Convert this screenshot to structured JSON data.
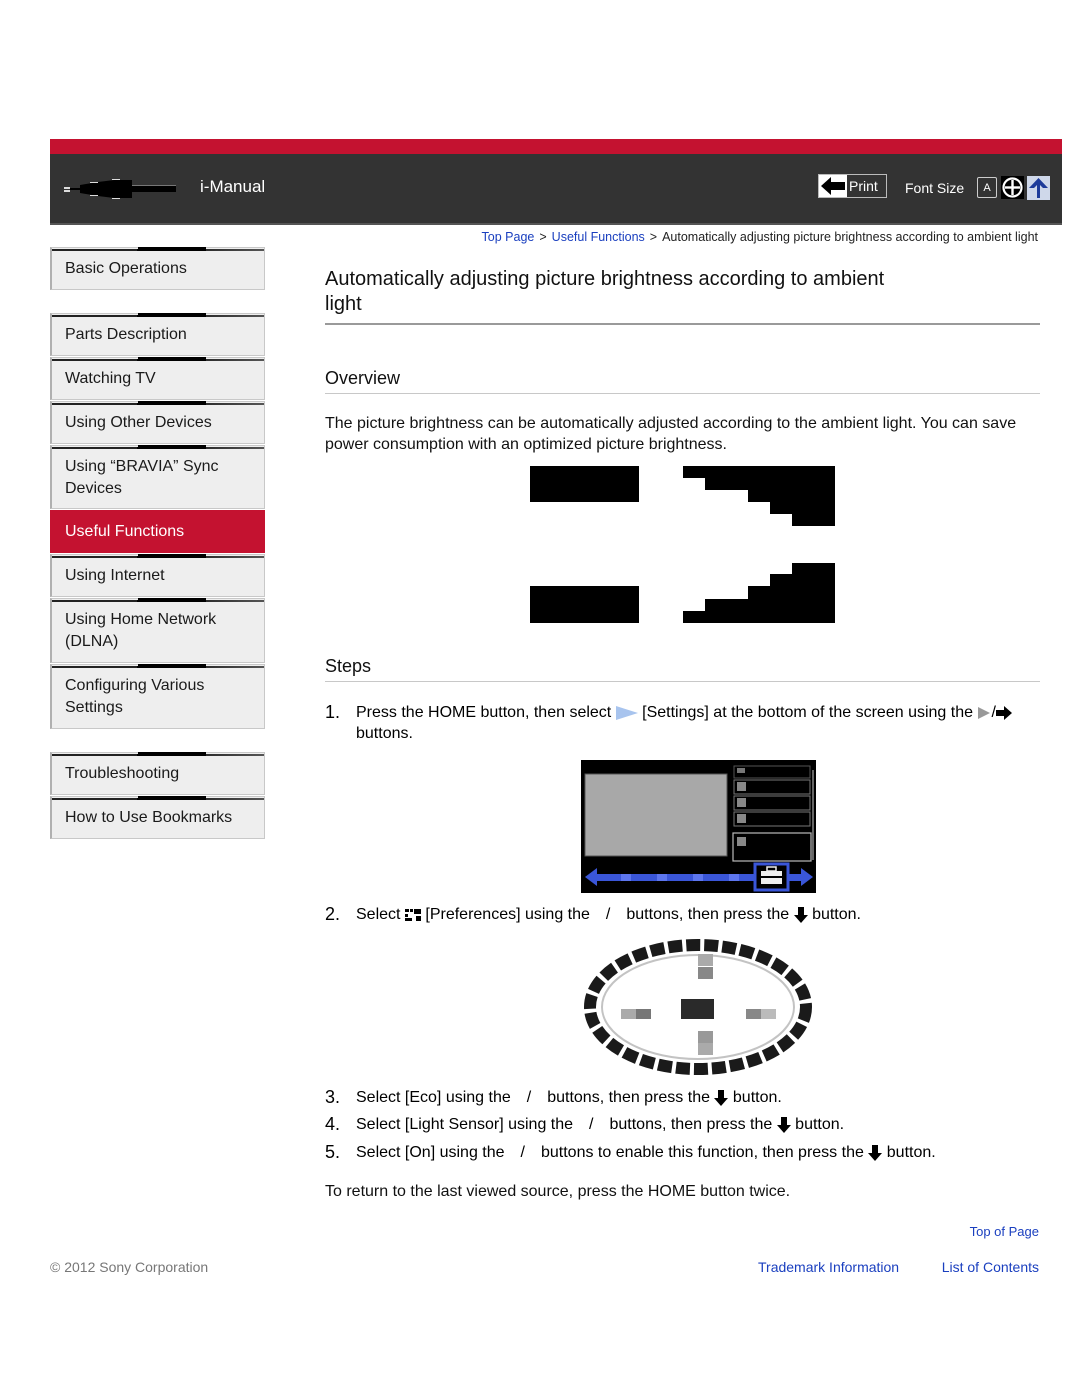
{
  "header": {
    "app_title": "i-Manual",
    "print_label": "Print",
    "font_size_label": "Font Size",
    "font_a_label": "A",
    "colors": {
      "brand_red": "#c41230",
      "header_bg": "#333333",
      "link_blue": "#1a3fbf"
    }
  },
  "breadcrumb": {
    "items": [
      "Top Page",
      "Useful Functions"
    ],
    "current": "Automatically adjusting picture brightness according to ambient light",
    "separator": ">"
  },
  "sidebar": {
    "items": [
      {
        "label": "Basic Operations",
        "active": false
      },
      {
        "label": "Parts Description",
        "active": false
      },
      {
        "label": "Watching TV",
        "active": false
      },
      {
        "label": "Using Other Devices",
        "active": false
      },
      {
        "label": "Using “BRAVIA” Sync Devices",
        "active": false
      },
      {
        "label": "Useful Functions",
        "active": true
      },
      {
        "label": "Using Internet",
        "active": false
      },
      {
        "label": "Using Home Network (DLNA)",
        "active": false
      },
      {
        "label": "Configuring Various Settings",
        "active": false
      },
      {
        "label": "Troubleshooting",
        "active": false
      },
      {
        "label": "How to Use Bookmarks",
        "active": false
      }
    ]
  },
  "main": {
    "title": "Automatically adjusting picture brightness according to ambient light",
    "overview": {
      "heading": "Overview",
      "text": "The picture brightness can be automatically adjusted according to the ambient light. You can save power consumption with an optimized picture brightness."
    },
    "steps": {
      "heading": "Steps",
      "items": [
        {
          "num": "1.",
          "parts": [
            "Press the HOME button, then select",
            "[Settings] at the bottom of the screen using the",
            "/",
            "buttons."
          ]
        },
        {
          "num": "2.",
          "parts": [
            "Select",
            "[Preferences] using the",
            "/",
            "buttons, then press the",
            "button."
          ]
        },
        {
          "num": "3.",
          "parts": [
            "Select [Eco] using the",
            "/",
            "buttons, then press the",
            "button."
          ]
        },
        {
          "num": "4.",
          "parts": [
            "Select [Light Sensor] using the",
            "/",
            "buttons, then press the",
            "button."
          ]
        },
        {
          "num": "5.",
          "parts": [
            "Select [On] using the",
            "/",
            "buttons to enable this function, then press the",
            "button."
          ]
        }
      ]
    },
    "return_note": "To return to the last viewed source, press the HOME button twice."
  },
  "footer": {
    "top_of_page": "Top of Page",
    "copyright": "© 2012 Sony Corporation",
    "trademark": "Trademark Information",
    "list_of_contents": "List of Contents"
  }
}
